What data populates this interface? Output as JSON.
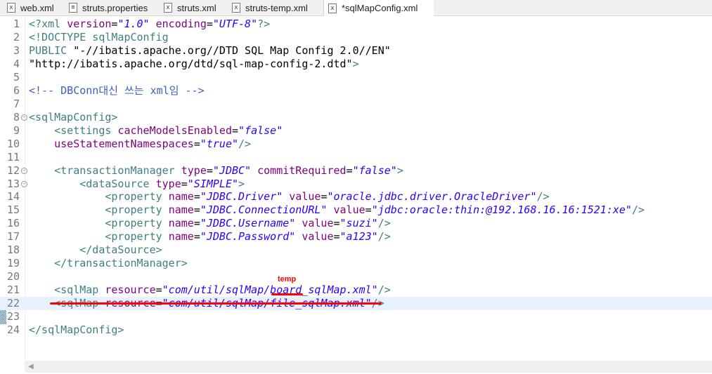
{
  "tabs": [
    {
      "label": "web.xml",
      "icon": "xml-file-icon"
    },
    {
      "label": "struts.properties",
      "icon": "properties-file-icon"
    },
    {
      "label": "struts.xml",
      "icon": "xml-file-icon"
    },
    {
      "label": "struts-temp.xml",
      "icon": "xml-file-icon"
    },
    {
      "label": "*sqlMapConfig.xml",
      "icon": "xml-file-icon",
      "active": true
    }
  ],
  "annotation": "temp",
  "lines": [
    [
      [
        "t",
        "<?"
      ],
      [
        "t",
        "xml "
      ],
      [
        "a",
        "version"
      ],
      [
        "p",
        "="
      ],
      [
        "v",
        "\"1.0\""
      ],
      [
        "p",
        " "
      ],
      [
        "a",
        "encoding"
      ],
      [
        "p",
        "="
      ],
      [
        "v",
        "\"UTF-8\""
      ],
      [
        "t",
        "?>"
      ]
    ],
    [
      [
        "t",
        "<!DOCTYPE sqlMapConfig"
      ]
    ],
    [
      [
        "t",
        "PUBLIC "
      ],
      [
        "p",
        "\"-//ibatis.apache.org//DTD SQL Map Config 2.0//EN\""
      ]
    ],
    [
      [
        "p",
        "\"http://ibatis.apache.org/dtd/sql-map-config-2.dtd\""
      ],
      [
        "t",
        ">"
      ]
    ],
    [],
    [
      [
        "c",
        "<!-- DBConn대신 쓰는 xml임 -->"
      ]
    ],
    [],
    [
      [
        "t",
        "<sqlMapConfig>"
      ]
    ],
    [
      [
        "p",
        "    "
      ],
      [
        "t",
        "<settings "
      ],
      [
        "a",
        "cacheModelsEnabled"
      ],
      [
        "p",
        "="
      ],
      [
        "v",
        "\"false\""
      ]
    ],
    [
      [
        "p",
        "    "
      ],
      [
        "a",
        "useStatementNamespaces"
      ],
      [
        "p",
        "="
      ],
      [
        "v",
        "\"true\""
      ],
      [
        "t",
        "/>"
      ]
    ],
    [],
    [
      [
        "p",
        "    "
      ],
      [
        "t",
        "<transactionManager "
      ],
      [
        "a",
        "type"
      ],
      [
        "p",
        "="
      ],
      [
        "v",
        "\"JDBC\""
      ],
      [
        "p",
        " "
      ],
      [
        "a",
        "commitRequired"
      ],
      [
        "p",
        "="
      ],
      [
        "v",
        "\"false\""
      ],
      [
        "t",
        ">"
      ]
    ],
    [
      [
        "p",
        "        "
      ],
      [
        "t",
        "<dataSource "
      ],
      [
        "a",
        "type"
      ],
      [
        "p",
        "="
      ],
      [
        "v",
        "\"SIMPLE\""
      ],
      [
        "t",
        ">"
      ]
    ],
    [
      [
        "p",
        "            "
      ],
      [
        "t",
        "<property "
      ],
      [
        "a",
        "name"
      ],
      [
        "p",
        "="
      ],
      [
        "v",
        "\"JDBC.Driver\""
      ],
      [
        "p",
        " "
      ],
      [
        "a",
        "value"
      ],
      [
        "p",
        "="
      ],
      [
        "v",
        "\"oracle.jdbc.driver.OracleDriver\""
      ],
      [
        "t",
        "/>"
      ]
    ],
    [
      [
        "p",
        "            "
      ],
      [
        "t",
        "<property "
      ],
      [
        "a",
        "name"
      ],
      [
        "p",
        "="
      ],
      [
        "v",
        "\"JDBC.ConnectionURL\""
      ],
      [
        "p",
        " "
      ],
      [
        "a",
        "value"
      ],
      [
        "p",
        "="
      ],
      [
        "v",
        "\"jdbc:oracle:thin:@192.168.16.16:1521:xe\""
      ],
      [
        "t",
        "/>"
      ]
    ],
    [
      [
        "p",
        "            "
      ],
      [
        "t",
        "<property "
      ],
      [
        "a",
        "name"
      ],
      [
        "p",
        "="
      ],
      [
        "v",
        "\"JDBC.Username\""
      ],
      [
        "p",
        " "
      ],
      [
        "a",
        "value"
      ],
      [
        "p",
        "="
      ],
      [
        "v",
        "\"suzi\""
      ],
      [
        "t",
        "/>"
      ]
    ],
    [
      [
        "p",
        "            "
      ],
      [
        "t",
        "<property "
      ],
      [
        "a",
        "name"
      ],
      [
        "p",
        "="
      ],
      [
        "v",
        "\"JDBC.Password\""
      ],
      [
        "p",
        " "
      ],
      [
        "a",
        "value"
      ],
      [
        "p",
        "="
      ],
      [
        "v",
        "\"a123\""
      ],
      [
        "t",
        "/>"
      ]
    ],
    [
      [
        "p",
        "        "
      ],
      [
        "t",
        "</dataSource>"
      ]
    ],
    [
      [
        "p",
        "    "
      ],
      [
        "t",
        "</transactionManager>"
      ]
    ],
    [],
    [
      [
        "p",
        "    "
      ],
      [
        "t",
        "<sqlMap "
      ],
      [
        "a",
        "resource"
      ],
      [
        "p",
        "="
      ],
      [
        "v",
        "\"com/util/sqlMap/board_sqlMap.xml\""
      ],
      [
        "t",
        "/>"
      ]
    ],
    [
      [
        "p",
        "    "
      ],
      [
        "t",
        "<sqlMap "
      ],
      [
        "a",
        "resource"
      ],
      [
        "p",
        "="
      ],
      [
        "v",
        "\"com/util/sqlMap/file_sqlMap.xml\""
      ],
      [
        "t",
        "/>"
      ]
    ],
    [],
    [
      [
        "t",
        "</sqlMapConfig>"
      ]
    ]
  ],
  "fold_lines": [
    8,
    12,
    13
  ],
  "current_line": 22
}
